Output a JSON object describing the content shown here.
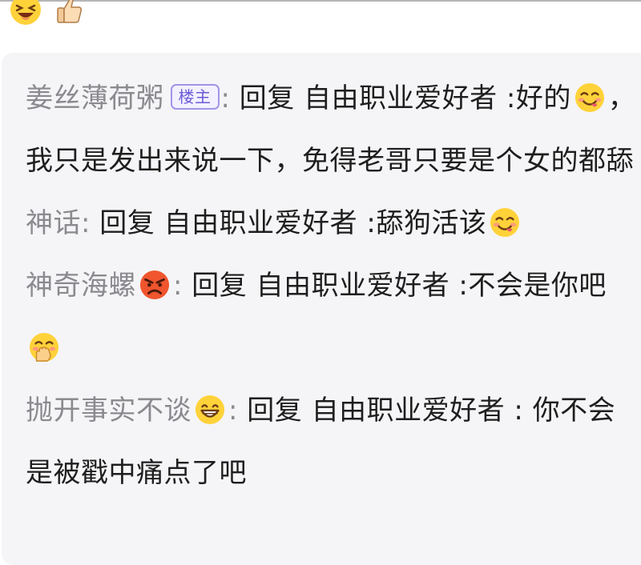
{
  "top_reactions": [
    {
      "icon": "laughing-face-icon"
    },
    {
      "icon": "thumbs-up-icon"
    }
  ],
  "replies": [
    {
      "author": "姜丝薄荷粥",
      "author_emoji": "",
      "badge": "楼主",
      "separator": ":",
      "text": " 回复 自由职业爱好者 :好的",
      "emoji": "yum-face-icon",
      "text_after": "，我只是发出来说一下，免得老哥只要是个女的都舔"
    },
    {
      "author": "神话",
      "separator": ":",
      "text": " 回复 自由职业爱好者 :舔狗活该",
      "emoji": "yum-face-icon",
      "text_after": ""
    },
    {
      "author": "神奇海螺",
      "author_emoji": "angry-face-icon",
      "separator": ":",
      "text": " 回复 自由职业爱好者 :不会是你吧",
      "emoji": "hand-over-mouth-icon",
      "text_after": ""
    },
    {
      "author": "抛开事实不谈",
      "author_emoji": "grinning-face-icon",
      "separator": ":",
      "text": " 回复 自由职业爱好者 : 你不会是被戳中痛点了吧",
      "emoji": "",
      "text_after": ""
    }
  ],
  "colors": {
    "author": "#8a8a8f",
    "text": "#1e1e1e",
    "panel_bg": "#f5f5f7",
    "badge": "#6b5bd8"
  }
}
